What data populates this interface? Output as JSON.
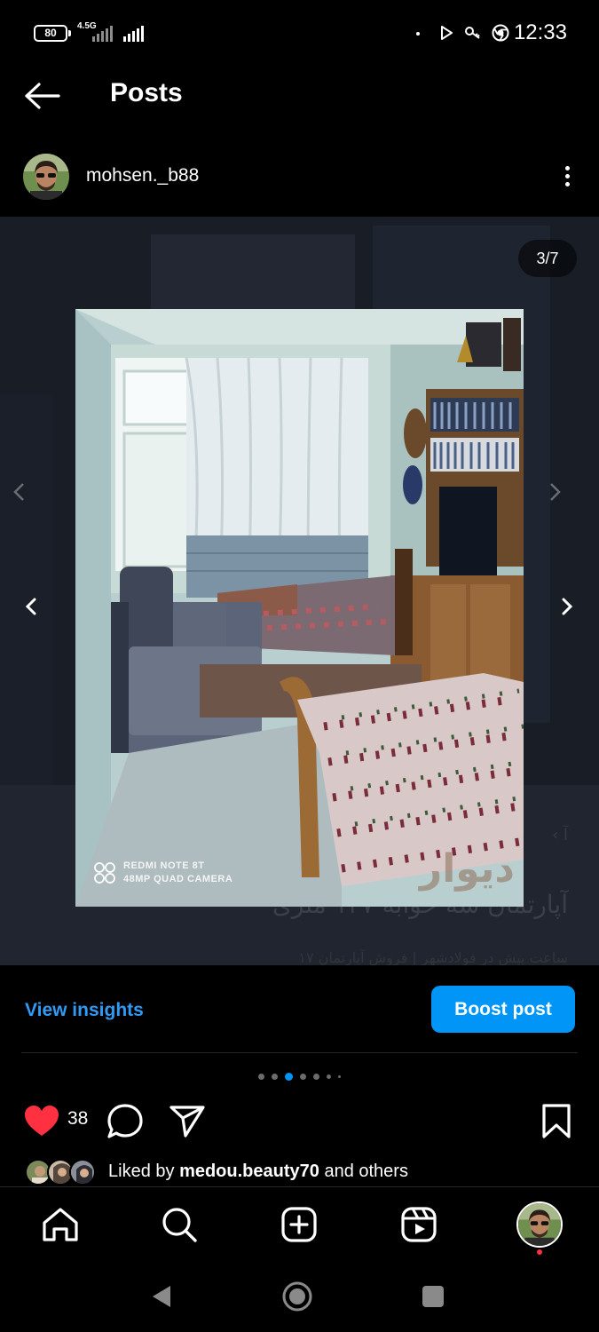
{
  "status_bar": {
    "battery": "80",
    "network": "4.5G",
    "time": "12:33"
  },
  "header": {
    "title": "Posts"
  },
  "post": {
    "username": "mohsen._b88",
    "media_counter": "3/7",
    "watermark_line1": "REDMI NOTE 8T",
    "watermark_line2": "48MP QUAD CAMERA",
    "carousel": {
      "total": 7,
      "active_index": 3
    }
  },
  "insights": {
    "view_label": "View insights",
    "boost_label": "Boost post"
  },
  "actions": {
    "like_count": "38"
  },
  "liked_by": {
    "prefix": "Liked by ",
    "user": "medou.beauty70",
    "suffix": " and others"
  },
  "colors": {
    "accent": "#0095f6",
    "link": "#2f9bf5",
    "like": "#ff3040",
    "background": "#000000"
  },
  "icons": {
    "back": "arrow-left-icon",
    "more": "more-vertical-icon",
    "like": "heart-filled-icon",
    "comment": "comment-icon",
    "share": "send-icon",
    "save": "bookmark-icon",
    "home": "home-icon",
    "search": "search-icon",
    "create": "plus-square-icon",
    "reels": "reels-icon"
  }
}
